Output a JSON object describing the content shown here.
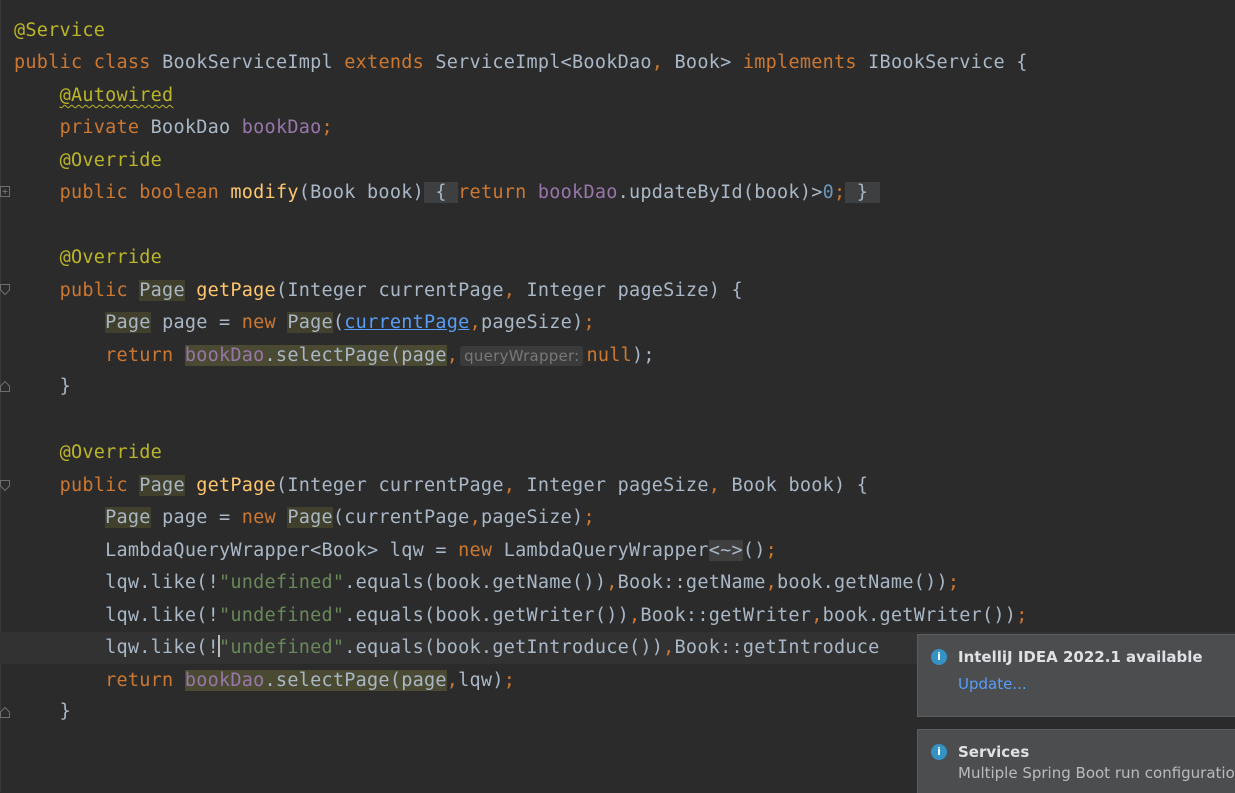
{
  "code": {
    "l1": {
      "annotation": "@Service"
    },
    "l2": {
      "kw_public": "public",
      "kw_class": "class",
      "class_name": "BookServiceImpl",
      "kw_extends": "extends",
      "parent": "ServiceImpl<BookDao",
      "comma": ",",
      "generic2": "Book>",
      "kw_implements": "implements",
      "iface": "IBookService {"
    },
    "l3": {
      "annotation": "@Autowired"
    },
    "l4": {
      "kw": "private",
      "type": "BookDao",
      "field": "bookDao",
      "end": ";"
    },
    "l5": {
      "annotation": "@Override"
    },
    "l6": {
      "kw_public": "public",
      "kw_bool": "boolean",
      "method": "modify",
      "params": "(Book book)",
      "fold_open": "{",
      "kw_return": "return",
      "field": "bookDao",
      "call": ".updateById(book)>",
      "num": "0",
      "semi": ";",
      "fold_close": "}"
    },
    "l8": {
      "annotation": "@Override"
    },
    "l9": {
      "kw_public": "public",
      "type": "Page",
      "method": "getPage",
      "p1": "(Integer currentPage",
      "comma": ",",
      "p2": "Integer pageSize) {"
    },
    "l10": {
      "type": "Page",
      "var": "page =",
      "kw_new": "new",
      "ctor": "Page",
      "paren": "(",
      "link": "currentPage",
      "comma": ",",
      "rest": "pageSize)",
      "semi": ";"
    },
    "l11": {
      "kw_return": "return",
      "field": "bookDao",
      "call": ".selectPage(page",
      "comma": ",",
      "hint": "queryWrapper:",
      "kw_null": "null",
      "end": ");"
    },
    "l12": {
      "brace": "}"
    },
    "l14": {
      "annotation": "@Override"
    },
    "l15": {
      "kw_public": "public",
      "type": "Page",
      "method": "getPage",
      "p1": "(Integer currentPage",
      "c1": ",",
      "p2": "Integer pageSize",
      "c2": ",",
      "p3": "Book book) {"
    },
    "l16": {
      "type": "Page",
      "var": "page =",
      "kw_new": "new",
      "ctor": "Page",
      "args": "(currentPage",
      "comma": ",",
      "rest": "pageSize)",
      "semi": ";"
    },
    "l17": {
      "type": "LambdaQueryWrapper<Book> lqw =",
      "kw_new": "new",
      "ctor": "LambdaQueryWrapper",
      "diamond": "<~>",
      "end": "()",
      "semi": ";"
    },
    "l18": {
      "a": "lqw.like(!",
      "str": "\"undefined\"",
      "b": ".equals(book.getName())",
      "c1": ",",
      "d": "Book::getName",
      "c2": ",",
      "e": "book.getName())",
      "semi": ";"
    },
    "l19": {
      "a": "lqw.like(!",
      "str": "\"undefined\"",
      "b": ".equals(book.getWriter())",
      "c1": ",",
      "d": "Book::getWriter",
      "c2": ",",
      "e": "book.getWriter())",
      "semi": ";"
    },
    "l20": {
      "a": "lqw.like(!",
      "str": "\"undefined\"",
      "b": ".equals(book.getIntroduce())",
      "c1": ",",
      "d": "Book::getIntroduce"
    },
    "l21": {
      "kw_return": "return",
      "field": "bookDao",
      "call": ".selectPage(page",
      "comma": ",",
      "rest": "lqw)",
      "semi": ";"
    },
    "l22": {
      "brace": "}"
    }
  },
  "notifications": [
    {
      "title": "IntelliJ IDEA 2022.1 available",
      "action": "Update...",
      "icon": "info-icon"
    },
    {
      "title": "Services",
      "body": "Multiple Spring Boot run configuration",
      "icon": "info-icon"
    }
  ],
  "colors": {
    "background": "#2b2b2b",
    "keyword": "#cc7832",
    "annotation": "#bbb529",
    "method": "#ffc66d",
    "field": "#9876aa",
    "string": "#6a8759",
    "number": "#6897bb",
    "link": "#589df6"
  }
}
